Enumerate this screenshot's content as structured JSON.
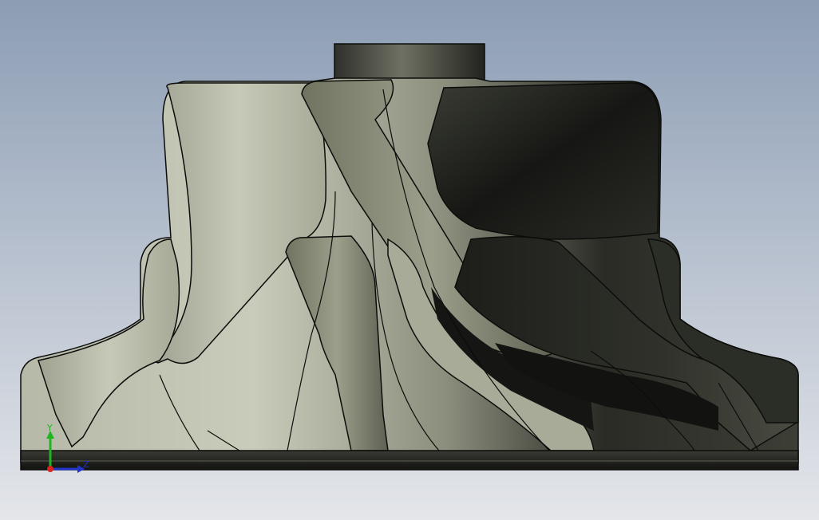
{
  "viewport": {
    "background_top": "#8c9db4",
    "background_bottom": "#e4e6ea"
  },
  "model": {
    "name": "impeller",
    "metal_light": "#c9cbbb",
    "metal_mid": "#8a8d7c",
    "metal_dark": "#1b1c18",
    "edge_color": "#0c0c0a"
  },
  "triad": {
    "y_label": "Y",
    "z_label": "Z",
    "y_color": "#1fb51f",
    "z_color": "#2135c8",
    "origin_color": "#d8231e"
  }
}
